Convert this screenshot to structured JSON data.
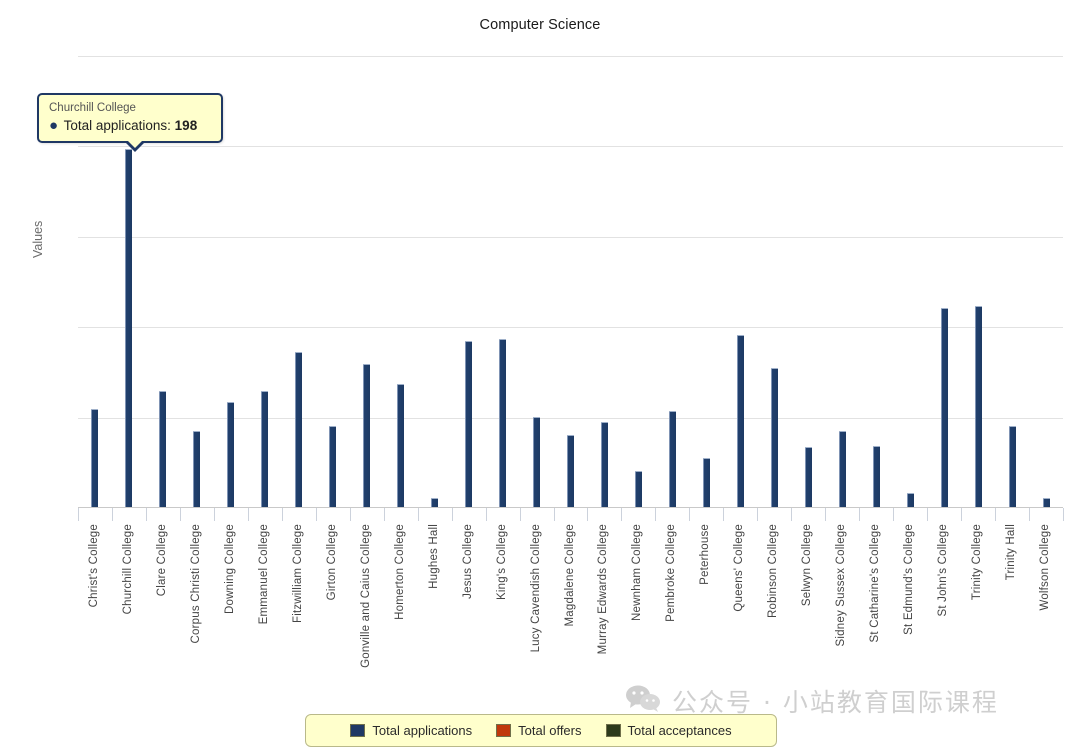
{
  "chart_data": {
    "type": "bar",
    "title": "Computer Science",
    "xlabel": "",
    "ylabel": "Values",
    "ylim": [
      0,
      250
    ],
    "yticks": [
      0,
      50,
      100,
      150,
      200,
      250
    ],
    "grid": true,
    "legend_position": "bottom",
    "categories": [
      "Christ's College",
      "Churchill College",
      "Clare College",
      "Corpus Christi College",
      "Downing College",
      "Emmanuel College",
      "Fitzwilliam College",
      "Girton College",
      "Gonville and Caius College",
      "Homerton College",
      "Hughes Hall",
      "Jesus College",
      "King's College",
      "Lucy Cavendish College",
      "Magdalene College",
      "Murray Edwards College",
      "Newnham College",
      "Pembroke College",
      "Peterhouse",
      "Queens' College",
      "Robinson College",
      "Selwyn College",
      "Sidney Sussex College",
      "St Catharine's College",
      "St Edmund's College",
      "St John's College",
      "Trinity College",
      "Trinity Hall",
      "Wolfson College"
    ],
    "series": [
      {
        "name": "Total applications",
        "color": "#1f3864",
        "values": [
          54,
          198,
          64,
          42,
          58,
          64,
          86,
          45,
          79,
          68,
          5,
          92,
          93,
          50,
          40,
          47,
          20,
          53,
          27,
          95,
          77,
          33,
          42,
          34,
          8,
          110,
          111,
          45,
          5
        ]
      },
      {
        "name": "Total offers",
        "color": "#c0380b",
        "values": []
      },
      {
        "name": "Total acceptances",
        "color": "#2d3a1b",
        "values": []
      }
    ]
  },
  "tooltip": {
    "category": "Churchill College",
    "series_name": "Total applications",
    "value": "198",
    "row_prefix": "Total applications:",
    "bullet": "●"
  },
  "legend": {
    "items": [
      {
        "label": "Total applications",
        "color": "#1f3864"
      },
      {
        "label": "Total offers",
        "color": "#c0380b"
      },
      {
        "label": "Total acceptances",
        "color": "#2d3a1b"
      }
    ]
  },
  "watermark": {
    "text": "公众号 · 小站教育国际课程",
    "icon": "wechat-icon"
  }
}
